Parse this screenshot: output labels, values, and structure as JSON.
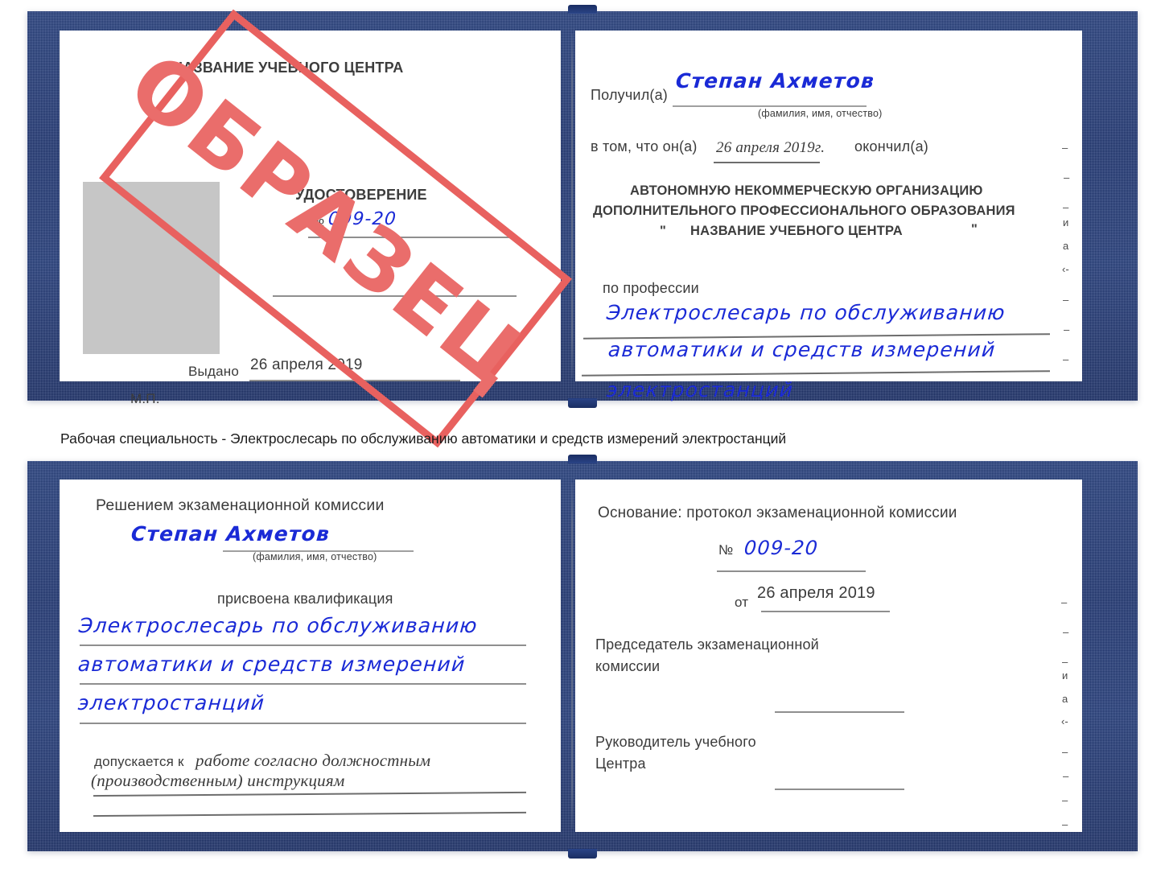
{
  "caption": {
    "text": "Рабочая специальность - Электрослесарь по обслуживанию автоматики и средств измерений электростанций"
  },
  "watermark": {
    "label": "ОБРАЗЕЦ",
    "color": "#ea6d6b"
  },
  "colors": {
    "cover_blue": "#243d7c",
    "handwriting_blue": "#1a2ad6",
    "stamp_red": "#ea6d6b",
    "photo_gray": "#c6c6c6",
    "rule_gray": "#8f8f8f"
  },
  "certificate_top": {
    "left_page": {
      "heading": "НАЗВАНИЕ УЧЕБНОГО ЦЕНТРА",
      "doc_type": "УДОСТОВЕРЕНИЕ",
      "number_label": "№",
      "number_value": "009-20",
      "issued_label": "Выдано",
      "issued_value": "26 апреля 2019",
      "seal_label": "М.П.",
      "photo_placeholder": "photo-placeholder"
    },
    "right_page": {
      "received_label": "Получил(а)",
      "received_value": "Степан Ахметов",
      "name_hint": "(фамилия, имя, отчество)",
      "that_label": "в том, что он(а)",
      "date_value": "26 апреля 2019г.",
      "finished_label": "окончил(а)",
      "org_line1": "АВТОНОМНУЮ НЕКОММЕРЧЕСКУЮ ОРГАНИЗАЦИЮ",
      "org_line2": "ДОПОЛНИТЕЛЬНОГО ПРОФЕССИОНАЛЬНОГО ОБРАЗОВАНИЯ",
      "org_quote_open": "\"",
      "org_line3": "НАЗВАНИЕ УЧЕБНОГО ЦЕНТРА",
      "org_quote_close": "\"",
      "profession_label": "по профессии",
      "profession_line1": "Электрослесарь по обслуживанию",
      "profession_line2": "автоматики и средств измерений",
      "profession_line3": "электростанций",
      "edge_marks": [
        "–",
        "–",
        "–",
        "и",
        "а",
        "‹-",
        "–",
        "–",
        "–"
      ]
    }
  },
  "certificate_bottom": {
    "left_page": {
      "heading": "Решением экзаменационной комиссии",
      "name_value": "Степан Ахметов",
      "name_hint": "(фамилия, имя, отчество)",
      "qualification_label": "присвоена квалификация",
      "qualification_line1": "Электрослесарь по обслуживанию",
      "qualification_line2": "автоматики и средств измерений",
      "qualification_line3": "электростанций",
      "admitted_label": "допускается к",
      "admitted_value_line1": "работе согласно должностным",
      "admitted_value_line2": "(производственным) инструкциям"
    },
    "right_page": {
      "basis_label": "Основание: протокол экзаменационной комиссии",
      "number_label": "№",
      "number_value": "009-20",
      "date_label": "от",
      "date_value": "26 апреля 2019",
      "chair_line1": "Председатель экзаменационной",
      "chair_line2": "комиссии",
      "head_line1": "Руководитель учебного",
      "head_line2": "Центра",
      "edge_marks": [
        "–",
        "–",
        "–",
        "и",
        "а",
        "‹-",
        "–",
        "–",
        "–",
        "–"
      ]
    }
  }
}
